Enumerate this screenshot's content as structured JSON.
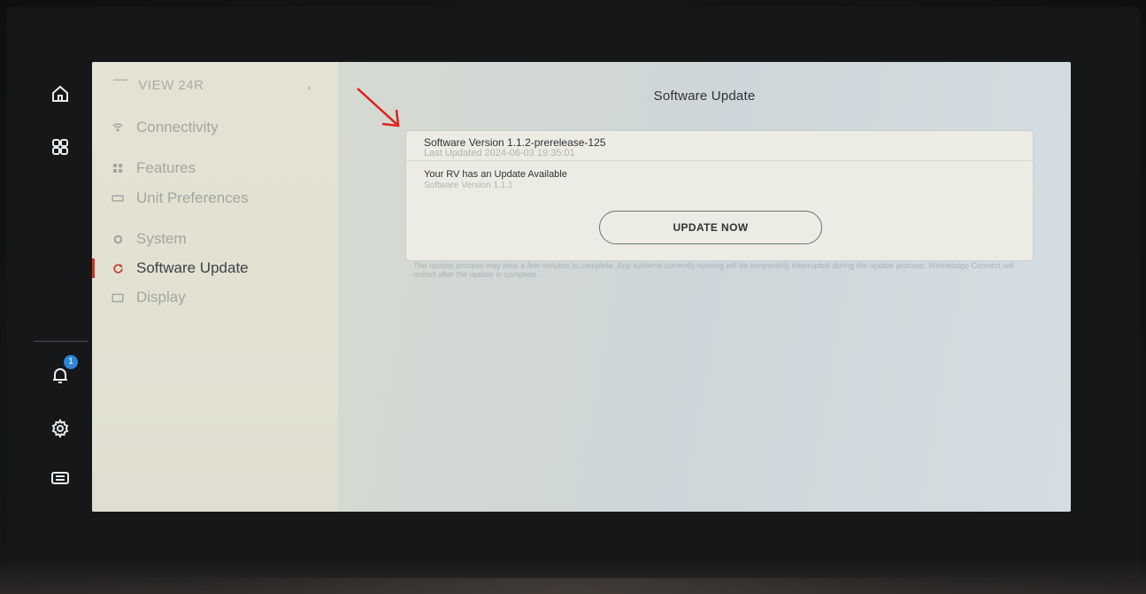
{
  "sidebar": {
    "title": "VIEW 24R",
    "items": [
      {
        "label": "Connectivity",
        "icon": "wifi-icon"
      },
      {
        "label": "Features",
        "icon": "grid-icon"
      },
      {
        "label": "Unit Preferences",
        "icon": "ruler-icon"
      },
      {
        "label": "System",
        "icon": "gear-icon"
      },
      {
        "label": "Software Update",
        "icon": "refresh-icon",
        "active": true
      },
      {
        "label": "Display",
        "icon": "display-icon"
      }
    ]
  },
  "rail": {
    "notification_count": "1",
    "icons": [
      "home-icon",
      "apps-icon",
      "bell-icon",
      "settings-icon",
      "keyboard-icon"
    ]
  },
  "main": {
    "title": "Software Update",
    "current": {
      "version": "Software Version 1.1.2-prerelease-125",
      "last_updated": "Last Updated 2024-06-03 19:35:01"
    },
    "available": {
      "heading": "Your RV has an Update Available",
      "version": "Software Version 1.1.1"
    },
    "update_button": "UPDATE NOW",
    "note": "The update process may take a few minutes to complete. Any systems currently running will be temporarily interrupted during the update process. Winnebago Connect will restart after the update is complete."
  },
  "colors": {
    "accent_active": "#c0392b",
    "badge": "#2f86d6",
    "annotation_arrow": "#e0201a"
  }
}
